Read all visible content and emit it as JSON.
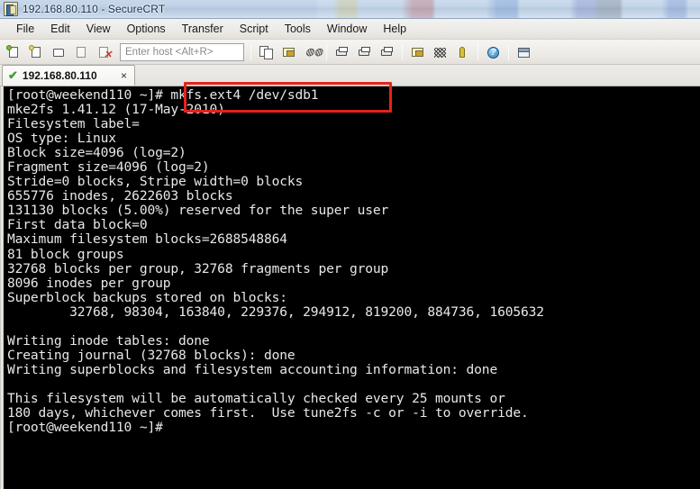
{
  "window": {
    "title": "192.168.80.110 - SecureCRT",
    "app_icon": "securecrt-icon"
  },
  "menubar": {
    "items": [
      {
        "label": "File"
      },
      {
        "label": "Edit"
      },
      {
        "label": "View"
      },
      {
        "label": "Options"
      },
      {
        "label": "Transfer"
      },
      {
        "label": "Script"
      },
      {
        "label": "Tools"
      },
      {
        "label": "Window"
      },
      {
        "label": "Help"
      }
    ]
  },
  "toolbar": {
    "host_placeholder": "Enter host <Alt+R>",
    "host_value": "",
    "buttons": [
      {
        "name": "new-session-icon",
        "title": "New Session"
      },
      {
        "name": "connect-sftp-icon",
        "title": "Connect SFTP"
      },
      {
        "name": "connect-local-shell-icon",
        "title": "Connect Local Shell"
      },
      {
        "name": "reconnect-icon",
        "title": "Reconnect"
      },
      {
        "name": "disconnect-icon",
        "title": "Disconnect"
      },
      {
        "name": "copy-icon",
        "title": "Copy"
      },
      {
        "name": "paste-icon",
        "title": "Paste"
      },
      {
        "name": "find-icon",
        "title": "Find"
      },
      {
        "name": "log-session-icon",
        "title": "Log Session"
      },
      {
        "name": "print-screen-icon",
        "title": "Print Screen"
      },
      {
        "name": "print-icon",
        "title": "Print"
      },
      {
        "name": "session-options-icon",
        "title": "Session Options"
      },
      {
        "name": "global-options-icon",
        "title": "Global Options"
      },
      {
        "name": "key-icon",
        "title": "Key"
      },
      {
        "name": "help-icon",
        "title": "Help"
      },
      {
        "name": "tile-windows-icon",
        "title": "Arrange Windows"
      }
    ]
  },
  "tabs": [
    {
      "label": "192.168.80.110",
      "status_icon": "green-check-icon",
      "close_label": "×",
      "active": true
    }
  ],
  "terminal": {
    "prompt": "[root@weekend110 ~]# ",
    "command": "mkfs.ext4 /dev/sdb1",
    "lines": [
      "[root@weekend110 ~]# mkfs.ext4 /dev/sdb1",
      "mke2fs 1.41.12 (17-May-2010)",
      "Filesystem label=",
      "OS type: Linux",
      "Block size=4096 (log=2)",
      "Fragment size=4096 (log=2)",
      "Stride=0 blocks, Stripe width=0 blocks",
      "655776 inodes, 2622603 blocks",
      "131130 blocks (5.00%) reserved for the super user",
      "First data block=0",
      "Maximum filesystem blocks=2688548864",
      "81 block groups",
      "32768 blocks per group, 32768 fragments per group",
      "8096 inodes per group",
      "Superblock backups stored on blocks:",
      "        32768, 98304, 163840, 229376, 294912, 819200, 884736, 1605632",
      "",
      "Writing inode tables: done",
      "Creating journal (32768 blocks): done",
      "Writing superblocks and filesystem accounting information: done",
      "",
      "This filesystem will be automatically checked every 25 mounts or",
      "180 days, whichever comes first.  Use tune2fs -c or -i to override.",
      "[root@weekend110 ~]#"
    ]
  },
  "annotation": {
    "name": "red-highlight-box",
    "color": "#e4221c",
    "target_text": "mkfs.ext4 /dev/sdb1"
  },
  "colors": {
    "terminal_bg": "#000000",
    "terminal_fg": "#e8e8e8",
    "titlebar": "#bed0e6",
    "accent_red": "#e4221c",
    "tab_check_green": "#3f9c35"
  }
}
